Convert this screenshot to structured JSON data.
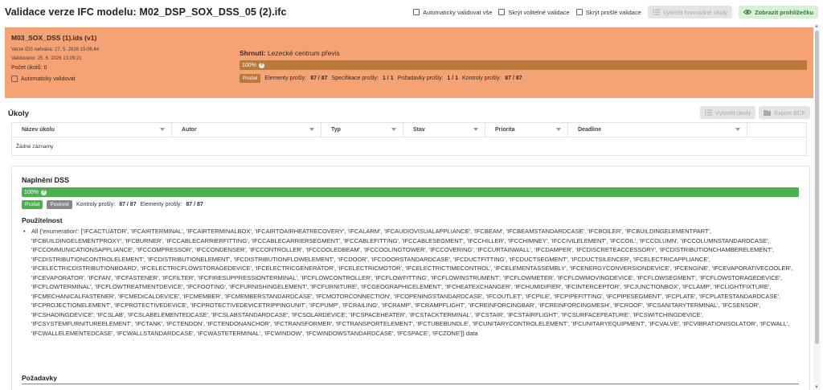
{
  "header": {
    "title": "Validace verze IFC modelu: M02_DSP_SOX_DSS_05 (2).ifc",
    "auto_validate_all": "Automaticky validovat vše",
    "hide_optional": "Skrýt volitelné validace",
    "hide_passed": "Skrýt prošlé validace",
    "bulk_tasks_button": "Vytvořit hromadné úkoly",
    "viewer_button": "Zobrazit prohlížečku"
  },
  "ids": {
    "name": "M03_SOX_DSS (1).ids (v1)",
    "uploaded": "Verze IDS nahrána: 27. 5. 2026 15:06:44",
    "validated": "Validováno: 25. 6. 2026 13:09:21",
    "task_count": "Počet úkolů: 0",
    "auto_validate": "Automaticky validovat",
    "summary_label": "Shrnutí:",
    "summary_value": "Lezecké centrum převis",
    "progress_label": "100%",
    "progress": 1.0,
    "status": "Prošel",
    "elements_label": "Elementy prošly:",
    "elements_value": "87 / 87",
    "specs_label": "Specifikace prošly:",
    "specs_value": "1 / 1",
    "reqs_label": "Požadavky prošly:",
    "reqs_value": "1 / 1",
    "checks_label": "Kontroly prošly:",
    "checks_value": "87 / 87",
    "color": "#f5a275"
  },
  "tasks": {
    "title": "Úkoly",
    "create_button": "Vytvořit úkoly",
    "export_button": "Export BCF",
    "columns": [
      "Název úkolu",
      "Autor",
      "Typ",
      "Stav",
      "Priorita",
      "Deadline",
      ""
    ],
    "empty_text": "Žádné záznamy"
  },
  "spec": {
    "title": "Naplnění DSS",
    "progress_label": "100%",
    "progress": 1.0,
    "status": "Prošel",
    "mandatory": "Povinné",
    "checks_label": "Kontroly prošly:",
    "checks_value": "87 / 87",
    "elements_label": "Elementy prošly:",
    "elements_value": "87 / 87",
    "applicability_title": "Použitelnost",
    "applicability_text": "All {'enumeration': ['IFCACTUATOR', 'IFCAIRTERMINAL', 'IFCAIRTERMINALBOX', 'IFCAIRTOAIRHEATRECOVERY', 'IFCALARM', 'IFCAUDIOVISUALAPPLIANCE', 'IFCBEAM', 'IFCBEAMSTANDARDCASE', 'IFCBOILER', 'IFCBUILDINGELEMENTPART', 'IFCBUILDINGELEMENTPROXY', 'IFCBURNER', 'IFCCABLECARRIERFITTING', 'IFCCABLECARRIERSEGMENT', 'IFCCABLEFITTING', 'IFCCABLESEGMENT', 'IFCCHILLER', 'IFCCHIMNEY', 'IFCCIVILELEMENT', 'IFCCOIL', 'IFCCOLUMN', 'IFCCOLUMNSTANDARDCASE', 'IFCCOMMUNICATIONSAPPLIANCE', 'IFCCOMPRESSOR', 'IFCCONDENSER', 'IFCCONTROLLER', 'IFCCOOLEDBEAM', 'IFCCOOLINGTOWER', 'IFCCOVERING', 'IFCCURTAINWALL', 'IFCDAMPER', 'IFCDISCRETEACCESSORY', 'IFCDISTRIBUTIONCHAMBERELEMENT', 'IFCDISTRIBUTIONCONTROLELEMENT', 'IFCDISTRIBUTIONELEMENT', 'IFCDISTRIBUTIONFLOWELEMENT', 'IFCDOOR', 'IFCDOORSTANDARDCASE', 'IFCDUCTFITTING', 'IFCDUCTSEGMENT', 'IFCDUCTSILENCER', 'IFCELECTRICAPPLIANCE', 'IFCELECTRICDISTRIBUTIONBOARD', 'IFCELECTRICFLOWSTORAGEDEVICE', 'IFCELECTRICGENERATOR', 'IFCELECTRICMOTOR', 'IFCELECTRICTIMECONTROL', 'IFCELEMENTASSEMBLY', 'IFCENERGYCONVERSIONDEVICE', 'IFCENGINE', 'IFCEVAPORATIVECOOLER', 'IFCEVAPORATOR', 'IFCFAN', 'IFCFASTENER', 'IFCFILTER', 'IFCFIRESUPPRESSIONTERMINAL', 'IFCFLOWCONTROLLER', 'IFCFLOWFITTING', 'IFCFLOWINSTRUMENT', 'IFCFLOWMETER', 'IFCFLOWMOVINGDEVICE', 'IFCFLOWSEGMENT', 'IFCFLOWSTORAGEDEVICE', 'IFCFLOWTERMINAL', 'IFCFLOWTREATMENTDEVICE', 'IFCFOOTING', 'IFCFURNISHINGELEMENT', 'IFCFURNITURE', 'IFCGEOGRAPHICELEMENT', 'IFCHEATEXCHANGER', 'IFCHUMIDIFIER', 'IFCINTERCEPTOR', 'IFCJUNCTIONBOX', 'IFCLAMP', 'IFCLIGHTFIXTURE', 'IFCMECHANICALFASTENER', 'IFCMEDICALDEVICE', 'IFCMEMBER', 'IFCMEMBERSTANDARDCASE', 'IFCMOTORCONNECTION', 'IFCOPENINGSTANDARDCASE', 'IFCOUTLET', 'IFCPILE', 'IFCPIPEFITTING', 'IFCPIPESEGMENT', 'IFCPLATE', 'IFCPLATESTANDARDCASE', 'IFCPROJECTIONELEMENT', 'IFCPROTECTIVEDEVICE', 'IFCPROTECTIVEDEVICETRIPPINGUNIT', 'IFCPUMP', 'IFCRAILING', 'IFCRAMP', 'IFCRAMPFLIGHT', 'IFCREINFORCINGBAR', 'IFCREINFORCINGMESH', 'IFCROOF', 'IFCSANITARYTERMINAL', 'IFCSENSOR', 'IFCSHADINGDEVICE', 'IFCSLAB', 'IFCSLABELEMENTEDCASE', 'IFCSLABSTANDARDCASE', 'IFCSOLARDEVICE', 'IFCSPACEHEATER', 'IFCSTACKTERMINAL', 'IFCSTAIR', 'IFCSTAIRFLIGHT', 'IFCSURFACEFEATURE', 'IFCSWITCHINGDEVICE', 'IFCSYSTEMFURNITUREELEMENT', 'IFCTANK', 'IFCTENDON', 'IFCTENDONANCHOR', 'IFCTRANSFORMER', 'IFCTRANSPORTELEMENT', 'IFCTUBEBUNDLE', 'IFCUNITARYCONTROLELEMENT', 'IFCUNITARYEQUIPMENT', 'IFCVALVE', 'IFCVIBRATIONISOLATOR', 'IFCWALL', 'IFCWALLELEMENTEDCASE', 'IFCWALLSTANDARDCASE', 'IFCWASTETERMINAL', 'IFCWINDOW', 'IFCWINDOWSTANDARDCASE', 'IFCSPACE', 'IFCZONE']} data",
    "requirements_title": "Požadavky"
  },
  "colors": {
    "passed_green": "#4caf50",
    "summary_brown": "#b8793b",
    "viewer_button_text": "#2e7d32"
  }
}
